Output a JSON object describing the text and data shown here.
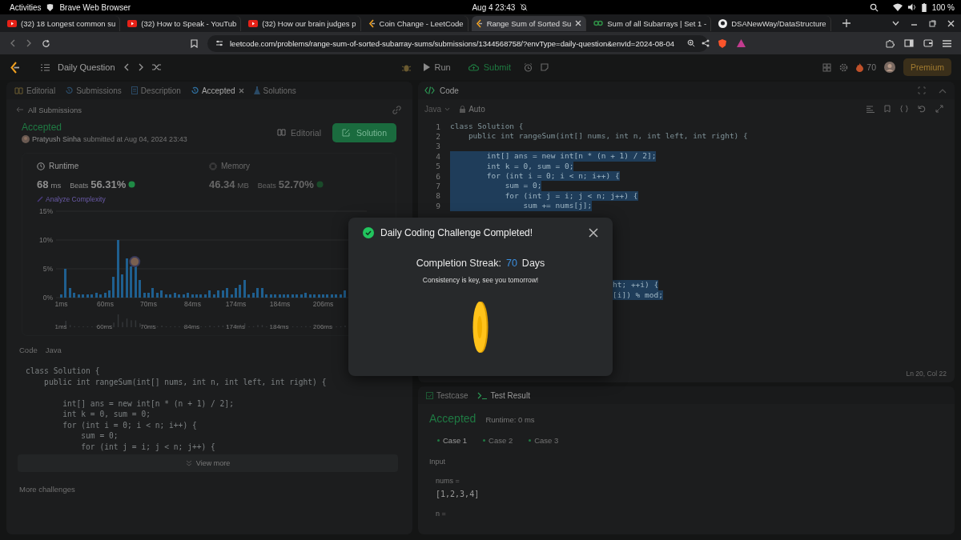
{
  "os_bar": {
    "activities": "Activities",
    "app_name": "Brave Web Browser",
    "clock": "Aug 4  23:43",
    "battery": "100 %"
  },
  "browser_tabs": [
    {
      "title": "(32) 18 Longest common su",
      "kind": "video",
      "selected": false
    },
    {
      "title": "(32) How to Speak - YouTub",
      "kind": "video",
      "selected": false
    },
    {
      "title": "(32) How our brain judges p",
      "kind": "video",
      "selected": false
    },
    {
      "title": "Coin Change - LeetCode",
      "kind": "problem",
      "selected": false
    },
    {
      "title": "Range Sum of Sorted Su",
      "kind": "problem",
      "selected": true
    },
    {
      "title": "Sum of all Subarrays | Set 1 -",
      "kind": "article",
      "selected": false
    },
    {
      "title": "DSANewWay/DataStructure",
      "kind": "repository",
      "selected": false
    }
  ],
  "address": {
    "url": "leetcode.com/problems/range-sum-of-sorted-subarray-sums/submissions/1344568758/?envType=daily-question&envId=2024-08-04"
  },
  "header": {
    "title": "Daily Question",
    "run": "Run",
    "submit": "Submit",
    "streak": "70",
    "premium": "Premium"
  },
  "left": {
    "tabs": [
      {
        "label": "Editorial",
        "selected": false
      },
      {
        "label": "Submissions",
        "selected": false
      },
      {
        "label": "Description",
        "selected": false
      },
      {
        "label": "Accepted",
        "selected": true
      },
      {
        "label": "Solutions",
        "selected": false
      }
    ],
    "back_link": "All Submissions",
    "status": "Accepted",
    "author": "Pratyush Sinha",
    "submitted": "submitted at Aug 04, 2024 23:43",
    "editorial_button": "Editorial",
    "solution_button": "Solution",
    "stats": [
      {
        "label": "Runtime",
        "value": "68",
        "unit": "ms",
        "beats_label": "Beats",
        "beats": "56.31%",
        "selected": true
      },
      {
        "label": "Memory",
        "value": "46.34",
        "unit": "MB",
        "beats_label": "Beats",
        "beats": "52.70%",
        "selected": false
      }
    ],
    "analyze": "Analyze Complexity",
    "chart_data": {
      "type": "bar",
      "yticks": [
        {
          "value": 0,
          "label": "0%"
        },
        {
          "value": 5,
          "label": "5%"
        },
        {
          "value": 10,
          "label": "10%"
        },
        {
          "value": 15,
          "label": "15%"
        }
      ],
      "ylim": [
        0,
        15
      ],
      "categories": [
        "1ms",
        null,
        null,
        null,
        null,
        null,
        null,
        null,
        null,
        null,
        "60ms",
        null,
        null,
        null,
        null,
        null,
        null,
        null,
        null,
        null,
        "70ms",
        null,
        null,
        null,
        null,
        null,
        null,
        null,
        null,
        null,
        "84ms",
        null,
        null,
        null,
        null,
        null,
        null,
        null,
        null,
        null,
        "174ms",
        null,
        null,
        null,
        null,
        null,
        null,
        null,
        null,
        null,
        "184ms",
        null,
        null,
        null,
        null,
        null,
        null,
        null,
        null,
        null,
        "206ms",
        null,
        null,
        null,
        null,
        null
      ],
      "values": [
        0.5,
        5,
        1.7,
        0.8,
        0.5,
        0.5,
        0.5,
        0.5,
        0.8,
        0.5,
        0.8,
        1.3,
        3.6,
        10,
        4,
        6.8,
        5.4,
        5.4,
        3.1,
        0.8,
        0.8,
        1.7,
        0.8,
        1.3,
        0.5,
        0.5,
        0.8,
        0.5,
        0.5,
        0.8,
        0.5,
        0.5,
        0.5,
        0.5,
        1.3,
        0.5,
        1.3,
        1.3,
        1.7,
        0.5,
        1.7,
        2.2,
        3.1,
        0.5,
        0.8,
        1.7,
        1.7,
        0.5,
        0.5,
        0.5,
        0.5,
        0.5,
        0.5,
        0.5,
        0.5,
        0.5,
        0.8,
        0.5,
        0.5,
        0.5,
        0.5,
        0.5,
        0.5,
        0.5,
        0.5,
        1.3
      ]
    },
    "overview_labels": [
      "1ms",
      "60ms",
      "70ms",
      "84ms",
      "174ms",
      "184ms",
      "206ms"
    ],
    "code_label": "Code",
    "code_language": "Java",
    "code_signature": [
      "class Solution {",
      "    public int rangeSum(int[] nums, int n, int left, int right) {"
    ],
    "code_body": [
      "        int[] ans = new int[n * (n + 1) / 2];",
      "        int k = 0, sum = 0;",
      "        for (int i = 0; i < n; i++) {",
      "            sum = 0;",
      "            for (int j = i; j < n; j++) {"
    ],
    "view_more": "View more",
    "more_challenges": "More challenges"
  },
  "editor": {
    "title": "Code",
    "language": "Java",
    "mode": "Auto",
    "lines": [
      {
        "number": "1",
        "text": "class Solution {",
        "selected": false
      },
      {
        "number": "2",
        "text": "    public int rangeSum(int[] nums, int n, int left, int right) {",
        "selected": false
      },
      {
        "number": "3"
      },
      {
        "number": "4",
        "text": "        int[] ans = new int[n * (n + 1) / 2];",
        "selected": true
      },
      {
        "number": "5",
        "text": "        int k = 0, sum = 0;",
        "selected": true
      },
      {
        "number": "6",
        "text": "        for (int i = 0; i < n; i++) {",
        "selected": true
      },
      {
        "number": "7",
        "text": "            sum = 0;",
        "selected": true
      },
      {
        "number": "8",
        "text": "            for (int j = i; j < n; j++) {",
        "selected": true
      },
      {
        "number": "9",
        "text": "                sum += nums[j];",
        "selected": true
      }
    ],
    "tail_lines": [
      {
        "text": "ht; ++i) {",
        "selected": true
      },
      {
        "text": "[i]) % mod;",
        "selected": true
      }
    ],
    "cursor": "Ln 20, Col 22"
  },
  "result": {
    "tabs": [
      {
        "label": "Testcase",
        "selected": false
      },
      {
        "label": "Test Result",
        "selected": true
      }
    ],
    "status": "Accepted",
    "runtime": "Runtime: 0 ms",
    "cases": [
      {
        "label": "Case 1",
        "selected": true
      },
      {
        "label": "Case 2",
        "selected": false
      },
      {
        "label": "Case 3",
        "selected": false
      }
    ],
    "input_label": "Input",
    "params": [
      {
        "name": "nums =",
        "value": "[1,2,3,4]"
      },
      {
        "name": "n ="
      }
    ]
  },
  "dialog": {
    "title": "Daily Coding Challenge Completed!",
    "streak_label": "Completion Streak:",
    "streak": "70",
    "streak_unit": "Days",
    "message": "Consistency is key, see you tomorrow!"
  }
}
